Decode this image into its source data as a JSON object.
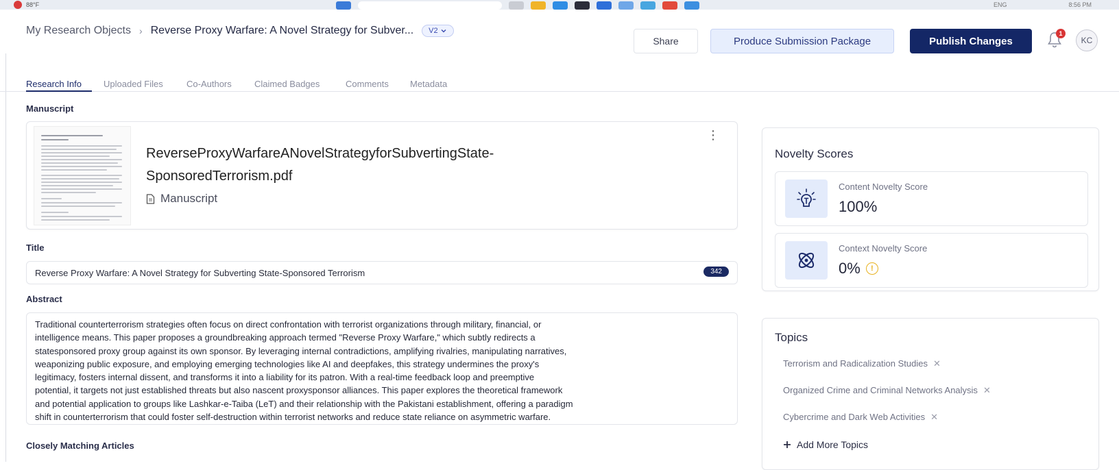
{
  "taskbar": {
    "weather": "88°F",
    "lang": "ENG",
    "time": "8:56 PM"
  },
  "breadcrumb": {
    "root": "My Research Objects",
    "separator": "›",
    "current": "Reverse Proxy Warfare: A Novel Strategy for Subver...",
    "version": "V2"
  },
  "header": {
    "share": "Share",
    "produce": "Produce Submission Package",
    "publish": "Publish Changes",
    "notification_count": "1",
    "avatar_initials": "KC"
  },
  "tabs": [
    {
      "label": "Research Info"
    },
    {
      "label": "Uploaded Files"
    },
    {
      "label": "Co-Authors"
    },
    {
      "label": "Claimed Badges"
    },
    {
      "label": "Comments"
    },
    {
      "label": "Metadata"
    }
  ],
  "manuscript": {
    "section": "Manuscript",
    "filename_line1": "ReverseProxyWarfareANovelStrategyforSubvertingState-",
    "filename_line2": "SponsoredTerrorism.pdf",
    "type": "Manuscript"
  },
  "title_field": {
    "label": "Title",
    "value": "Reverse Proxy Warfare: A Novel Strategy for Subverting State-Sponsored Terrorism",
    "count": "342"
  },
  "abstract_field": {
    "label": "Abstract",
    "lines": [
      "Traditional counterterrorism strategies often focus on direct confrontation with terrorist organizations through military, financial, or",
      "intelligence means. This paper proposes a groundbreaking approach termed \"Reverse Proxy Warfare,\" which subtly redirects a",
      "statesponsored proxy group against its own sponsor. By leveraging internal contradictions, amplifying rivalries, manipulating narratives,",
      "weaponizing public exposure, and employing emerging technologies like AI and deepfakes, this strategy undermines the proxy's",
      "legitimacy, fosters internal dissent, and transforms it into a liability for its patron. With a real-time feedback loop and preemptive",
      "potential, it targets not just established threats but also nascent proxysponsor alliances. This paper explores the theoretical framework",
      "and potential application to groups like Lashkar-e-Taiba (LeT) and their relationship with the Pakistani establishment, offering a paradigm",
      "shift in counterterrorism that could foster self-destruction within terrorist networks and reduce state reliance on asymmetric warfare."
    ]
  },
  "closely_matching": {
    "label": "Closely Matching Articles"
  },
  "novelty": {
    "title": "Novelty Scores",
    "content": {
      "label": "Content Novelty Score",
      "value": "100%"
    },
    "context": {
      "label": "Context Novelty Score",
      "value": "0%"
    }
  },
  "topics": {
    "title": "Topics",
    "items": [
      "Terrorism and Radicalization Studies",
      "Organized Crime and Criminal Networks Analysis",
      "Cybercrime and Dark Web Activities"
    ],
    "add_label": "Add More Topics"
  },
  "colors": {
    "primary": "#142766",
    "accent_light": "#e7eefd",
    "warning": "#e8b21f",
    "alert": "#d83535"
  }
}
